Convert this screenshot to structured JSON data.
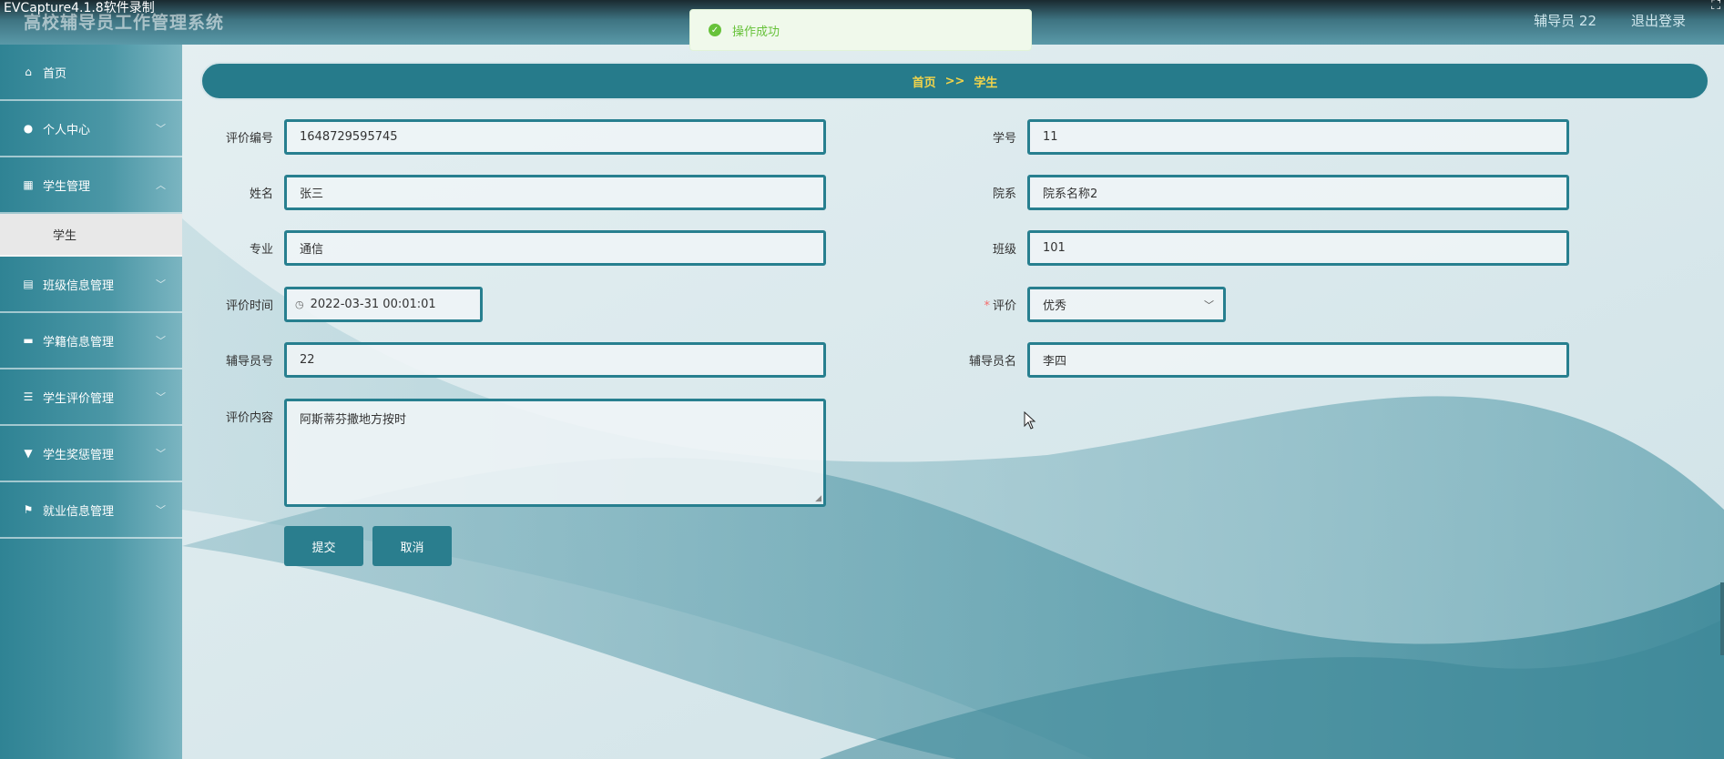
{
  "recorder_label": "EVCapture4.1.8软件录制",
  "header": {
    "title": "高校辅导员工作管理系统",
    "user": "辅导员 22",
    "logout": "退出登录"
  },
  "toast": {
    "message": "操作成功",
    "icon": "check-circle-icon"
  },
  "sidebar": {
    "items": [
      {
        "label": "首页",
        "icon": "home-icon"
      },
      {
        "label": "个人中心",
        "icon": "user-icon"
      },
      {
        "label": "学生管理",
        "icon": "grid-icon"
      },
      {
        "label": "学生",
        "sub": true
      },
      {
        "label": "班级信息管理",
        "icon": "clipboard-icon"
      },
      {
        "label": "学籍信息管理",
        "icon": "briefcase-icon"
      },
      {
        "label": "学生评价管理",
        "icon": "sliders-icon"
      },
      {
        "label": "学生奖惩管理",
        "icon": "trophy-icon"
      },
      {
        "label": "就业信息管理",
        "icon": "flag-icon"
      }
    ]
  },
  "breadcrumb": {
    "home": "首页",
    "separator": ">>",
    "current": "学生"
  },
  "form": {
    "eval_no": {
      "label": "评价编号",
      "value": "1648729595745"
    },
    "student_no": {
      "label": "学号",
      "value": "11"
    },
    "name": {
      "label": "姓名",
      "value": "张三"
    },
    "department": {
      "label": "院系",
      "value": "院系名称2"
    },
    "major": {
      "label": "专业",
      "value": "通信"
    },
    "class": {
      "label": "班级",
      "value": "101"
    },
    "eval_time": {
      "label": "评价时间",
      "value": "2022-03-31 00:01:01"
    },
    "evaluation": {
      "label": "评价",
      "value": "优秀",
      "required_mark": "*"
    },
    "counselor_no": {
      "label": "辅导员号",
      "value": "22"
    },
    "counselor_name": {
      "label": "辅导员名",
      "value": "李四"
    },
    "content": {
      "label": "评价内容",
      "value": "阿斯蒂芬撒地方按时"
    }
  },
  "buttons": {
    "submit": "提交",
    "cancel": "取消"
  },
  "colors": {
    "accent": "#267b8b",
    "breadcrumb_text": "#f2d44a",
    "toast_green": "#67c23a"
  }
}
